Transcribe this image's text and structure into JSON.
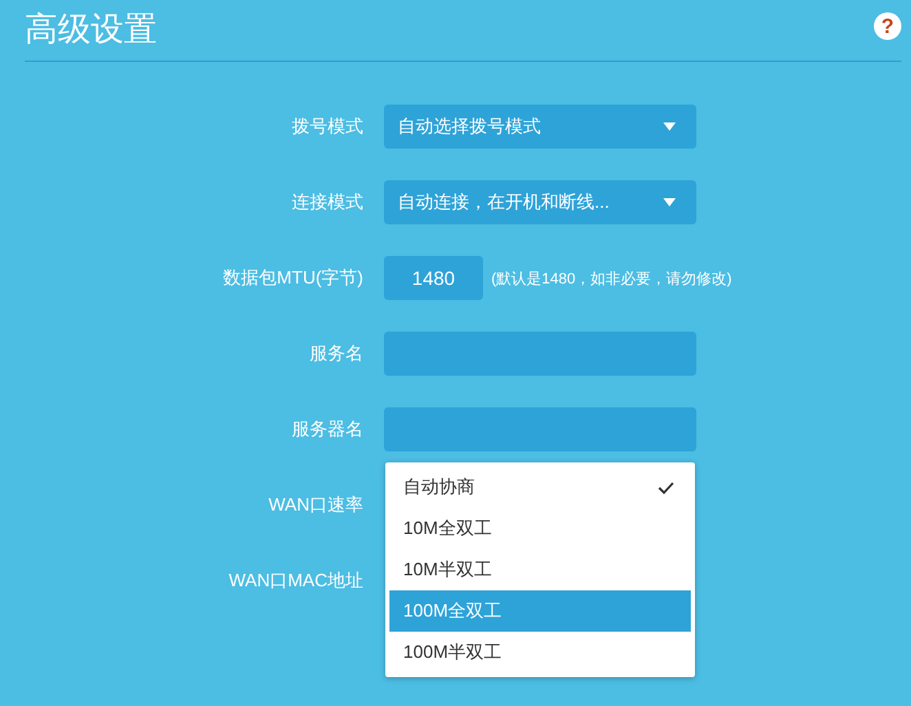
{
  "title": "高级设置",
  "help": "?",
  "rows": [
    {
      "kind": "select",
      "label": "拨号模式",
      "value": "自动选择拨号模式"
    },
    {
      "kind": "select",
      "label": "连接模式",
      "value": "自动连接，在开机和断线..."
    },
    {
      "kind": "mtu",
      "label": "数据包MTU(字节)",
      "value": "1480",
      "note": "(默认是1480，如非必要，请勿修改)"
    },
    {
      "kind": "text",
      "label": "服务名"
    },
    {
      "kind": "text",
      "label": "服务器名"
    },
    {
      "kind": "menu",
      "label": "WAN口速率",
      "options": [
        {
          "label": "自动协商",
          "checked": true,
          "highlighted": false
        },
        {
          "label": "10M全双工",
          "checked": false,
          "highlighted": false
        },
        {
          "label": "10M半双工",
          "checked": false,
          "highlighted": false
        },
        {
          "label": "100M全双工",
          "checked": false,
          "highlighted": true
        },
        {
          "label": "100M半双工",
          "checked": false,
          "highlighted": false
        }
      ]
    },
    {
      "kind": "hidden",
      "label": "WAN口MAC地址"
    }
  ]
}
